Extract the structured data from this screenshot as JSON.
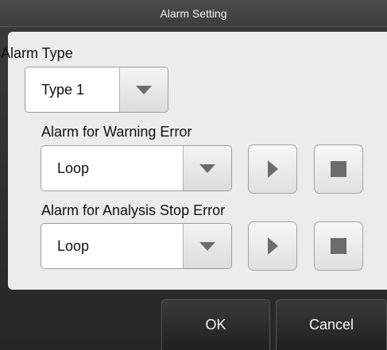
{
  "window": {
    "title": "Alarm Setting"
  },
  "alarm_type": {
    "label": "Alarm Type",
    "value": "Type 1",
    "arrow_icon": "chevron-down-icon"
  },
  "warning_error": {
    "label": "Alarm for Warning Error",
    "value": "Loop",
    "play_icon": "play-icon",
    "stop_icon": "stop-icon"
  },
  "analysis_stop_error": {
    "label": "Alarm for Analysis Stop Error",
    "value": "Loop",
    "play_icon": "play-icon",
    "stop_icon": "stop-icon"
  },
  "footer": {
    "ok_label": "OK",
    "cancel_label": "Cancel"
  },
  "colors": {
    "panel": "#ececec",
    "frame": "#2e2e2e",
    "icon": "#6c6c6c"
  }
}
